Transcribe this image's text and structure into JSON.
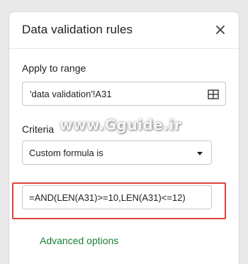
{
  "panel": {
    "title": "Data validation rules",
    "close_icon": "close-icon"
  },
  "apply_to_range": {
    "label": "Apply to range",
    "value": "'data validation'!A31",
    "icon": "grid-icon"
  },
  "criteria": {
    "label": "Criteria",
    "selected": "Custom formula is",
    "icon": "chevron-down-icon"
  },
  "formula": {
    "value": "=AND(LEN(A31)>=10,LEN(A31)<=12)"
  },
  "advanced_options": {
    "label": "Advanced options"
  },
  "watermark": {
    "text": "www.Gguide.ir"
  },
  "colors": {
    "accent_green": "#188038",
    "highlight_red": "#e0413c",
    "border": "#c7c7c7"
  }
}
